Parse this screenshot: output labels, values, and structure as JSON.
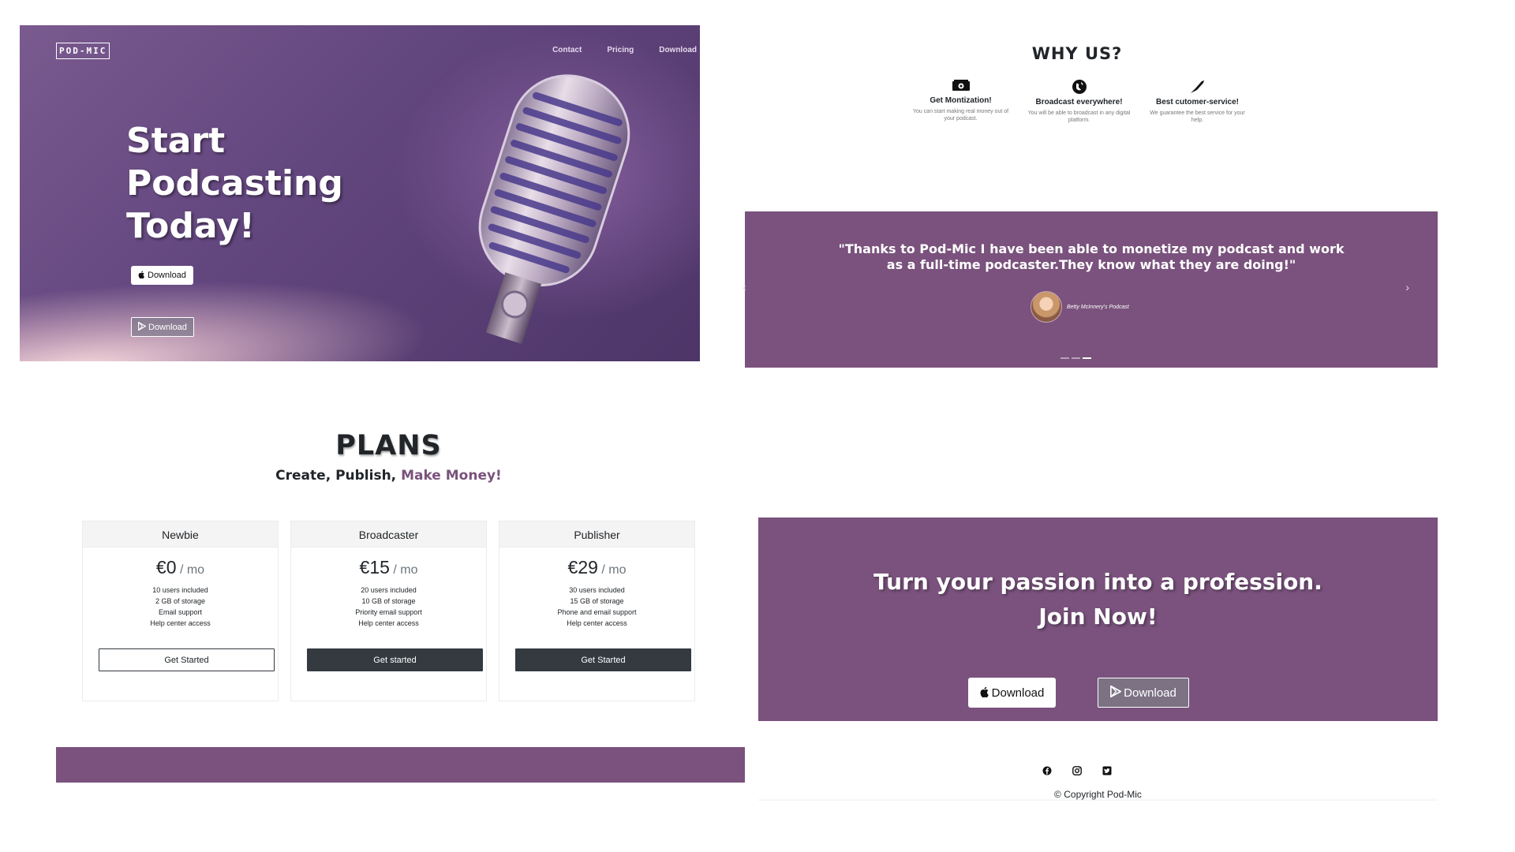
{
  "hero": {
    "logo": "POD-MIC",
    "nav": [
      "Contact",
      "Pricing",
      "Download"
    ],
    "title": "Start Podcasting Today!",
    "apple_download": "Download",
    "play_download": "Download",
    "icons": [
      "apple-icon",
      "google-play-icon",
      "microphone-image"
    ]
  },
  "why": {
    "title": "WHY US?",
    "features": [
      {
        "icon": "money-icon",
        "title": "Get Montization!",
        "text": "You can start making real money out of your podcast."
      },
      {
        "icon": "globe-icon",
        "title": "Broadcast everywhere!",
        "text": "You will be able to broadcast in any digital platform."
      },
      {
        "icon": "thumbs-up-icon",
        "title": "Best cutomer-service!",
        "text": "We guarantee the best service for your help."
      }
    ]
  },
  "testimonial": {
    "quote": "\"Thanks to Pod-Mic I have been able to monetize my podcast and work as a full-time podcaster.They know what they are doing!\"",
    "author": "Betty McInnery's Podcast",
    "indicator_active": 3,
    "indicator_count": 3
  },
  "plans": {
    "title": "PLANS",
    "subtitle_plain": "Create, Publish, ",
    "subtitle_accent": "Make Money!",
    "items": [
      {
        "name": "Newbie",
        "price": "€0",
        "period": " / mo",
        "features": [
          "10 users included",
          "2 GB of storage",
          "Email support",
          "Help center access"
        ],
        "button": "Get Started"
      },
      {
        "name": "Broadcaster",
        "price": "€15",
        "period": " / mo",
        "features": [
          "20 users included",
          "10 GB of storage",
          "Priority email support",
          "Help center access"
        ],
        "button": "Get started"
      },
      {
        "name": "Publisher",
        "price": "€29",
        "period": " / mo",
        "features": [
          "30 users included",
          "15 GB of storage",
          "Phone and email support",
          "Help center access"
        ],
        "button": "Get Started"
      }
    ]
  },
  "cta": {
    "line1": "Turn your passion into a profession.",
    "line2": "Join Now!",
    "apple_download": "Download",
    "play_download": "Download"
  },
  "footer": {
    "socials": [
      "facebook-icon",
      "instagram-icon",
      "twitter-icon"
    ],
    "copyright": "© Copyright Pod-Mic"
  },
  "colors": {
    "brand_purple": "#7a527d",
    "dark_button": "#343a40"
  }
}
